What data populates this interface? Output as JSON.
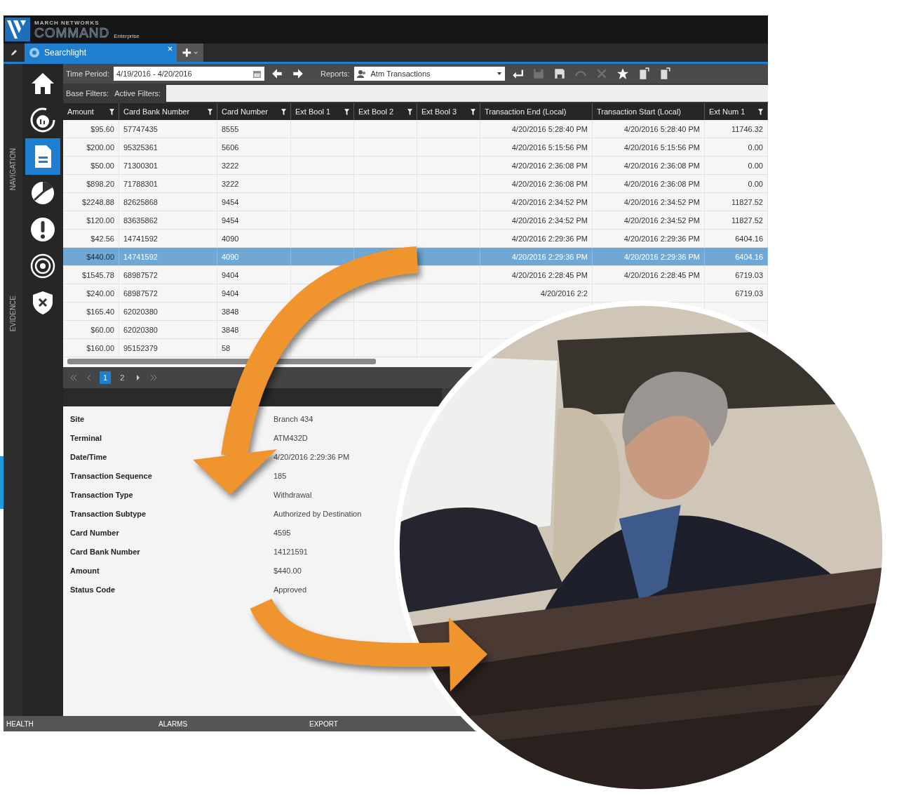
{
  "app": {
    "brand_top": "MARCH NETWORKS",
    "brand_name": "COMMAND",
    "brand_edition": "Enterprise"
  },
  "tabs": [
    {
      "label": "Searchlight",
      "selected": true
    }
  ],
  "sidebar": {
    "section_labels": [
      "NAVIGATION",
      "EVIDENCE"
    ],
    "items": [
      {
        "kind": "home",
        "selected": false
      },
      {
        "kind": "dashboard",
        "selected": false
      },
      {
        "kind": "document",
        "selected": true
      },
      {
        "kind": "slice",
        "selected": false
      },
      {
        "kind": "alert",
        "selected": false
      },
      {
        "kind": "target",
        "selected": false
      },
      {
        "kind": "shield",
        "selected": false
      }
    ]
  },
  "toolbar": {
    "time_period_label": "Time Period:",
    "time_period": "4/19/2016 - 4/20/2016",
    "reports_label": "Reports:",
    "report": "Atm Transactions"
  },
  "filters": {
    "base_label": "Base Filters:",
    "active_label": "Active Filters:"
  },
  "table": {
    "columns": [
      {
        "label": "Amount",
        "filter": true
      },
      {
        "label": "Card Bank Number",
        "filter": true
      },
      {
        "label": "Card Number",
        "filter": true
      },
      {
        "label": "Ext Bool 1",
        "filter": true
      },
      {
        "label": "Ext Bool 2",
        "filter": true
      },
      {
        "label": "Ext Bool 3",
        "filter": true
      },
      {
        "label": "Transaction End (Local)",
        "filter": false
      },
      {
        "label": "Transaction Start (Local)",
        "filter": false
      },
      {
        "label": "Ext Num 1",
        "filter": true
      }
    ],
    "rows": [
      {
        "selected": false,
        "cells": [
          "$95.60",
          "57747435",
          "8555",
          null,
          null,
          null,
          "4/20/2016 5:28:40 PM",
          "4/20/2016 5:28:40 PM",
          "11746.32"
        ]
      },
      {
        "selected": false,
        "cells": [
          "$200.00",
          "95325361",
          "5606",
          null,
          null,
          null,
          "4/20/2016 5:15:56 PM",
          "4/20/2016 5:15:56 PM",
          "0.00"
        ]
      },
      {
        "selected": false,
        "cells": [
          "$50.00",
          "71300301",
          "3222",
          null,
          null,
          null,
          "4/20/2016 2:36:08 PM",
          "4/20/2016 2:36:08 PM",
          "0.00"
        ]
      },
      {
        "selected": false,
        "cells": [
          "$898.20",
          "71788301",
          "3222",
          null,
          null,
          null,
          "4/20/2016 2:36:08 PM",
          "4/20/2016 2:36:08 PM",
          "0.00"
        ]
      },
      {
        "selected": false,
        "cells": [
          "$2248.88",
          "82625868",
          "9454",
          null,
          null,
          null,
          "4/20/2016 2:34:52 PM",
          "4/20/2016 2:34:52 PM",
          "11827.52"
        ]
      },
      {
        "selected": false,
        "cells": [
          "$120.00",
          "83635862",
          "9454",
          null,
          null,
          null,
          "4/20/2016 2:34:52 PM",
          "4/20/2016 2:34:52 PM",
          "11827.52"
        ]
      },
      {
        "selected": false,
        "cells": [
          "$42.56",
          "14741592",
          "4090",
          null,
          null,
          null,
          "4/20/2016 2:29:36 PM",
          "4/20/2016 2:29:36 PM",
          "6404.16"
        ]
      },
      {
        "selected": true,
        "cells": [
          "$440.00",
          "14741592",
          "4090",
          null,
          null,
          null,
          "4/20/2016 2:29:36 PM",
          "4/20/2016 2:29:36 PM",
          "6404.16"
        ]
      },
      {
        "selected": false,
        "cells": [
          "$1545.78",
          "68987572",
          "9404",
          null,
          null,
          null,
          "4/20/2016 2:28:45 PM",
          "4/20/2016 2:28:45 PM",
          "6719.03"
        ]
      },
      {
        "selected": false,
        "cells": [
          "$240.00",
          "68987572",
          "9404",
          null,
          null,
          null,
          "4/20/2016 2:2",
          null,
          "6719.03"
        ]
      },
      {
        "selected": false,
        "cells": [
          "$165.40",
          "62020380",
          "3848",
          null,
          null,
          null,
          null,
          null,
          null
        ]
      },
      {
        "selected": false,
        "cells": [
          "$60.00",
          "62020380",
          "3848",
          null,
          null,
          null,
          null,
          null,
          null
        ]
      },
      {
        "selected": false,
        "cells": [
          "$160.00",
          "95152379",
          "58",
          null,
          null,
          null,
          null,
          null,
          null
        ]
      }
    ]
  },
  "pager": {
    "pages": [
      {
        "label": "1",
        "selected": true
      },
      {
        "label": "2",
        "selected": false
      }
    ]
  },
  "details": [
    {
      "label": "Site",
      "value": "Branch 434"
    },
    {
      "label": "Terminal",
      "value": "ATM432D"
    },
    {
      "label": "Date/Time",
      "value": "4/20/2016 2:29:36 PM"
    },
    {
      "label": "Transaction Sequence",
      "value": "185"
    },
    {
      "label": "Transaction Type",
      "value": "Withdrawal"
    },
    {
      "label": "Transaction Subtype",
      "value": "Authorized by Destination"
    },
    {
      "label": "Card Number",
      "value": "4595"
    },
    {
      "label": "Card Bank Number",
      "value": "14121591"
    },
    {
      "label": "Amount",
      "value": "$440.00"
    },
    {
      "label": "Status Code",
      "value": "Approved"
    }
  ],
  "status_bar": [
    "HEALTH",
    "ALARMS",
    "EXPORT"
  ]
}
